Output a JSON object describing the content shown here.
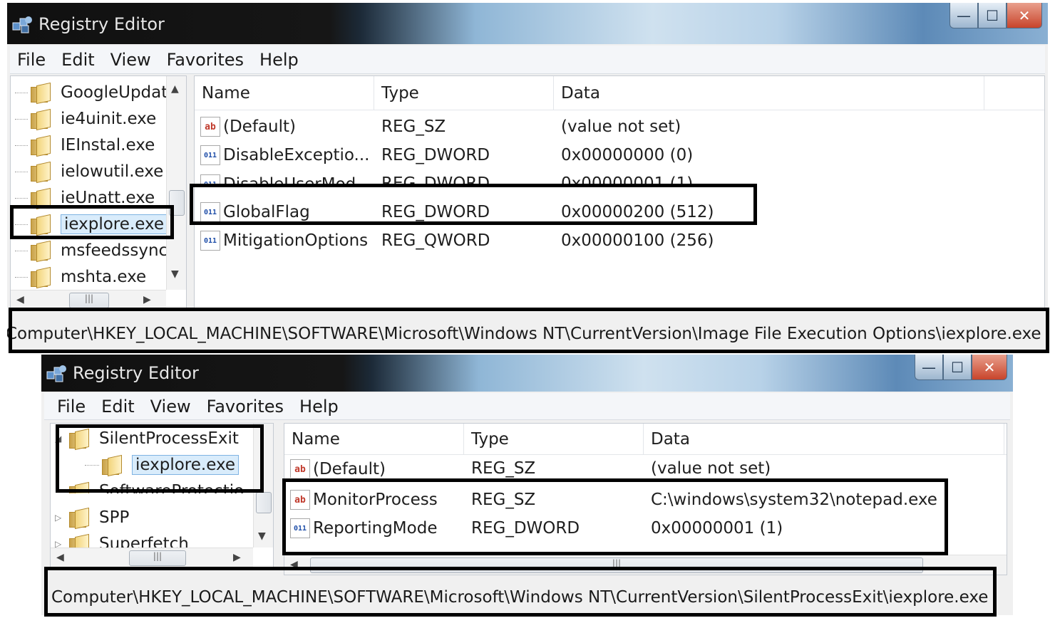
{
  "windows": [
    {
      "title": "Registry Editor",
      "window_buttons": {
        "minimize": "—",
        "maximize": "☐",
        "close": "✕"
      },
      "menu": [
        "File",
        "Edit",
        "View",
        "Favorites",
        "Help"
      ],
      "tree": [
        {
          "label": "GoogleUpdat"
        },
        {
          "label": "ie4uinit.exe"
        },
        {
          "label": "IEInstal.exe"
        },
        {
          "label": "ielowutil.exe"
        },
        {
          "label": "ieUnatt.exe"
        },
        {
          "label": "iexplore.exe",
          "selected": true
        },
        {
          "label": "msfeedssync."
        },
        {
          "label": "mshta.exe"
        }
      ],
      "columns": [
        "Name",
        "Type",
        "Data"
      ],
      "values": [
        {
          "icon": "string-value-icon",
          "icon_text": "ab",
          "name": "(Default)",
          "type": "REG_SZ",
          "data": "(value not set)"
        },
        {
          "icon": "binary-value-icon",
          "icon_text": "011",
          "name": "DisableExceptio...",
          "type": "REG_DWORD",
          "data": "0x00000000 (0)"
        },
        {
          "icon": "binary-value-icon",
          "icon_text": "011",
          "name": "DisableUserMod...",
          "type": "REG_DWORD",
          "data": "0x00000001 (1)"
        },
        {
          "icon": "binary-value-icon",
          "icon_text": "011",
          "name": "GlobalFlag",
          "type": "REG_DWORD",
          "data": "0x00000200 (512)"
        },
        {
          "icon": "binary-value-icon",
          "icon_text": "011",
          "name": "MitigationOptions",
          "type": "REG_QWORD",
          "data": "0x00000100 (256)"
        }
      ],
      "status_path": "Computer\\HKEY_LOCAL_MACHINE\\SOFTWARE\\Microsoft\\Windows NT\\CurrentVersion\\Image File Execution Options\\iexplore.exe"
    },
    {
      "title": "Registry Editor",
      "window_buttons": {
        "minimize": "—",
        "maximize": "☐",
        "close": "✕"
      },
      "menu": [
        "File",
        "Edit",
        "View",
        "Favorites",
        "Help"
      ],
      "tree": [
        {
          "label": "SilentProcessExit",
          "expander": "◢"
        },
        {
          "label": "iexplore.exe",
          "selected": true
        },
        {
          "label": "SoftwareProtectio"
        },
        {
          "label": "SPP",
          "expander": "▷"
        },
        {
          "label": "Superfetch",
          "expander": "▷"
        }
      ],
      "columns": [
        "Name",
        "Type",
        "Data"
      ],
      "values": [
        {
          "icon": "string-value-icon",
          "icon_text": "ab",
          "name": "(Default)",
          "type": "REG_SZ",
          "data": "(value not set)"
        },
        {
          "icon": "string-value-icon",
          "icon_text": "ab",
          "name": "MonitorProcess",
          "type": "REG_SZ",
          "data": "C:\\windows\\system32\\notepad.exe"
        },
        {
          "icon": "binary-value-icon",
          "icon_text": "011",
          "name": "ReportingMode",
          "type": "REG_DWORD",
          "data": "0x00000001 (1)"
        }
      ],
      "status_path": "Computer\\HKEY_LOCAL_MACHINE\\SOFTWARE\\Microsoft\\Windows NT\\CurrentVersion\\SilentProcessExit\\iexplore.exe"
    }
  ],
  "scroll_glyphs": {
    "up": "▲",
    "down": "▼",
    "left": "◀",
    "right": "▶",
    "grip": "|||"
  },
  "colors": {
    "highlight_box": "#000000",
    "selection": "#d9ecfb"
  }
}
